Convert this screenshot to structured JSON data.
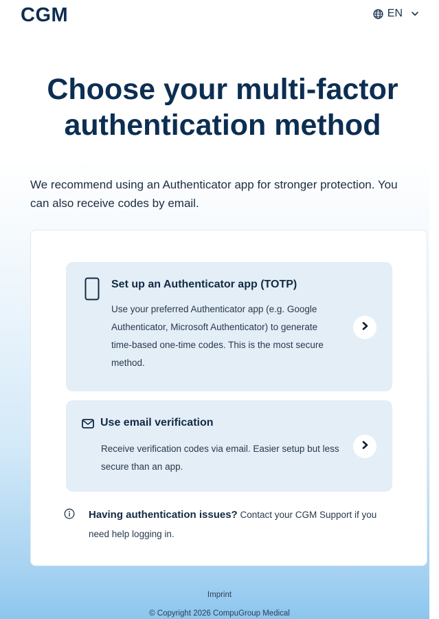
{
  "header": {
    "logo": "CGM",
    "language": {
      "label": "EN",
      "icon": "globe-icon",
      "dropdown_icon": "chevron-down-icon"
    }
  },
  "page": {
    "title": "Choose your multi-factor authentication method",
    "intro": "We recommend using an Authenticator app for stronger protection. You can also receive codes by email."
  },
  "options": [
    {
      "icon": "smartphone-icon",
      "title": "Set up an Authenticator app (TOTP)",
      "description": "Use your preferred Authenticator app (e.g. Google Authenticator, Microsoft Authenticator) to generate time-based one-time codes. This is the most secure method."
    },
    {
      "icon": "mail-icon",
      "title": "Use email verification",
      "description": "Receive verification codes via email. Easier setup but less secure than an app."
    }
  ],
  "help": {
    "icon": "info-icon",
    "heading": "Having authentication issues?",
    "text": "Contact your CGM Support if you need help logging in."
  },
  "footer": {
    "imprint": "Imprint",
    "copyright": "© Copyright 2026 CompuGroup Medical"
  },
  "colors": {
    "brand_navy": "#0c2e52",
    "option_background": "#e4eef7",
    "gradient_bottom": "#8cc6ee"
  }
}
